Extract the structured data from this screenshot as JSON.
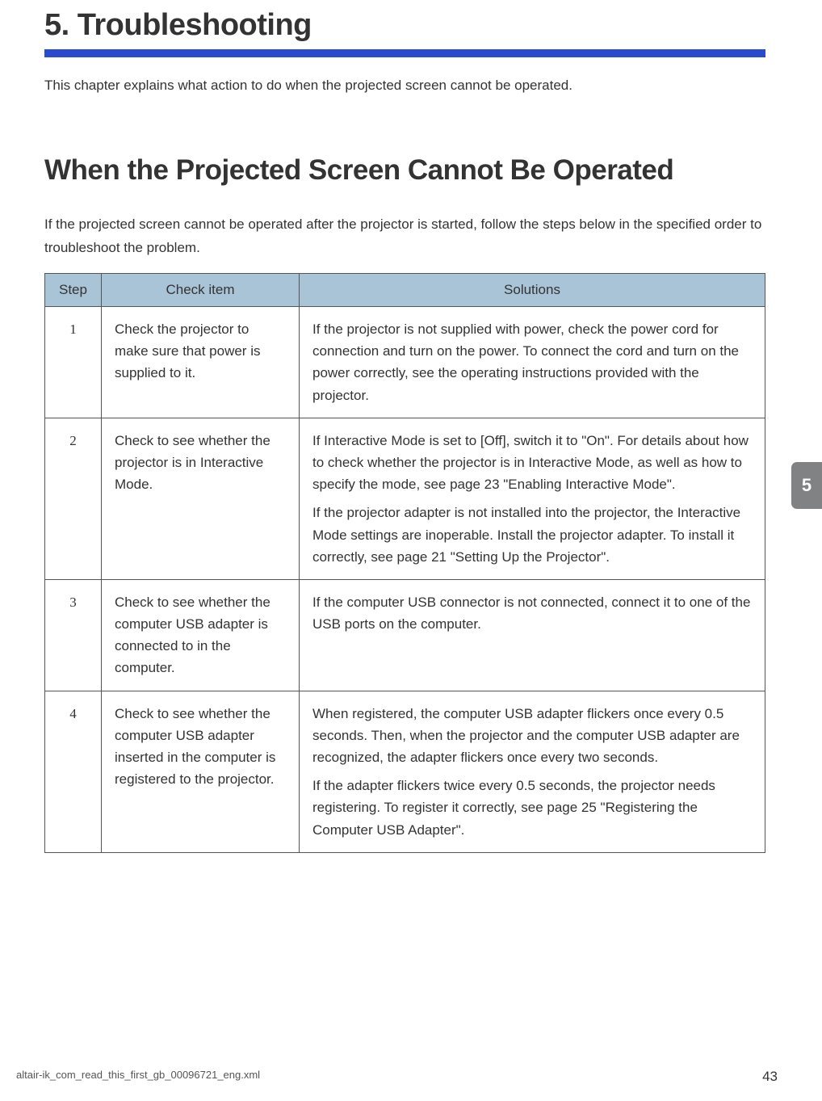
{
  "chapter": {
    "title": "5. Troubleshooting",
    "intro": "This chapter explains what action to do when the projected screen cannot be operated."
  },
  "side_tab": "5",
  "section": {
    "title": "When the Projected Screen Cannot Be Operated",
    "intro": "If the projected screen cannot be operated after the projector is started, follow the steps below in the specified order to troubleshoot the problem."
  },
  "table": {
    "headers": {
      "step": "Step",
      "check": "Check item",
      "solutions": "Solutions"
    },
    "rows": [
      {
        "step": "1",
        "check": "Check the projector to make sure that power is supplied to it.",
        "solutions": [
          "If the projector is not supplied with power, check the power cord for connection and turn on the power. To connect the cord and turn on the power correctly, see the operating instructions provided with the projector."
        ]
      },
      {
        "step": "2",
        "check": "Check to see whether the projector is in Interactive Mode.",
        "solutions": [
          "If Interactive Mode is set to [Off], switch it to \"On\". For details about how to check whether the projector is in Interactive Mode, as well as how to specify the mode, see page 23 \"Enabling Interactive Mode\".",
          "If the projector adapter is not installed into the projector, the Interactive Mode settings are inoperable. Install the projector adapter. To install it correctly, see page 21 \"Setting Up the Projector\"."
        ]
      },
      {
        "step": "3",
        "check": "Check to see whether the computer USB adapter is connected to in the computer.",
        "solutions": [
          "If the computer USB connector is not connected, connect it to one of the USB ports on the computer."
        ]
      },
      {
        "step": "4",
        "check": "Check to see whether the computer USB adapter inserted in the computer is registered to the projector.",
        "solutions": [
          "When registered, the computer USB adapter flickers once every 0.5 seconds. Then, when the projector and the computer USB adapter are recognized, the adapter flickers once every two seconds.",
          "If the adapter flickers twice every 0.5 seconds, the projector needs registering. To register it correctly, see page 25 \"Registering the Computer USB Adapter\"."
        ]
      }
    ]
  },
  "footer": {
    "filename": "altair-ik_com_read_this_first_gb_00096721_eng.xml",
    "page": "43"
  }
}
